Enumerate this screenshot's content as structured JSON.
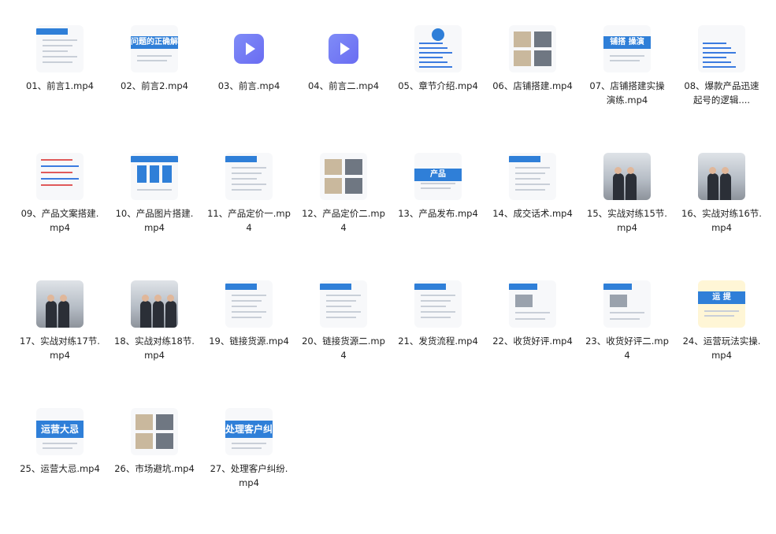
{
  "files": [
    {
      "name": "01、前言1.mp4",
      "thumb": "chat",
      "thumb_text": ""
    },
    {
      "name": "02、前言2.mp4",
      "thumb": "banner",
      "thumb_text": "问题的正确解决"
    },
    {
      "name": "03、前言.mp4",
      "thumb": "video",
      "thumb_text": ""
    },
    {
      "name": "04、前言二.mp4",
      "thumb": "video",
      "thumb_text": ""
    },
    {
      "name": "05、章节介绍.mp4",
      "thumb": "list",
      "thumb_text": ""
    },
    {
      "name": "06、店铺搭建.mp4",
      "thumb": "photo-grid",
      "thumb_text": ""
    },
    {
      "name": "07、店铺搭建实操演练.mp4",
      "thumb": "banner-split",
      "thumb_text": "铺搭 操演"
    },
    {
      "name": "08、爆款产品迅速起号的逻辑....",
      "thumb": "list-blue",
      "thumb_text": ""
    },
    {
      "name": "09、产品文案搭建.mp4",
      "thumb": "text-red",
      "thumb_text": ""
    },
    {
      "name": "10、产品图片搭建.mp4",
      "thumb": "table",
      "thumb_text": ""
    },
    {
      "name": "11、产品定价一.mp4",
      "thumb": "doc",
      "thumb_text": ""
    },
    {
      "name": "12、产品定价二.mp4",
      "thumb": "doc-photo",
      "thumb_text": ""
    },
    {
      "name": "13、产品发布.mp4",
      "thumb": "product",
      "thumb_text": "产品"
    },
    {
      "name": "14、成交话术.mp4",
      "thumb": "doc-light",
      "thumb_text": ""
    },
    {
      "name": "15、实战对练15节.mp4",
      "thumb": "people2",
      "thumb_text": ""
    },
    {
      "name": "16、实战对练16节.mp4",
      "thumb": "people2",
      "thumb_text": ""
    },
    {
      "name": "17、实战对练17节.mp4",
      "thumb": "people2",
      "thumb_text": ""
    },
    {
      "name": "18、实战对练18节.mp4",
      "thumb": "people3",
      "thumb_text": ""
    },
    {
      "name": "19、链接货源.mp4",
      "thumb": "doc-lines",
      "thumb_text": ""
    },
    {
      "name": "20、链接货源二.mp4",
      "thumb": "doc-lines",
      "thumb_text": ""
    },
    {
      "name": "21、发货流程.mp4",
      "thumb": "doc-lines",
      "thumb_text": ""
    },
    {
      "name": "22、收货好评.mp4",
      "thumb": "doc-grey",
      "thumb_text": ""
    },
    {
      "name": "23、收货好评二.mp4",
      "thumb": "doc-grey",
      "thumb_text": ""
    },
    {
      "name": "24、运营玩法实操.mp4",
      "thumb": "yellow",
      "thumb_text": "运 提"
    },
    {
      "name": "25、运营大忌.mp4",
      "thumb": "bigbanner",
      "thumb_text": "运营大忌"
    },
    {
      "name": "26、市场避坑.mp4",
      "thumb": "collage",
      "thumb_text": ""
    },
    {
      "name": "27、处理客户纠纷.mp4",
      "thumb": "bigbanner",
      "thumb_text": "处理客户纠纷"
    }
  ],
  "colors": {
    "accent": "#2f7fd8",
    "play_icon": "#7077f4",
    "text": "#222222"
  },
  "icons": {
    "video": "play-icon"
  }
}
